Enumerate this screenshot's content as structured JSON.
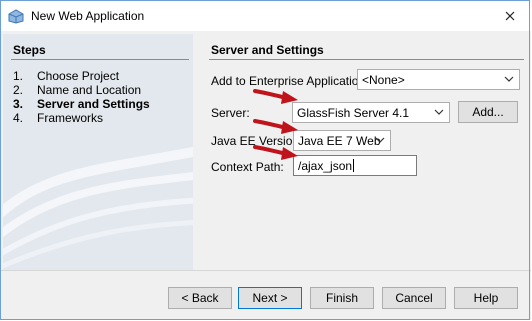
{
  "window": {
    "title": "New Web Application",
    "app_icon": "netbeans-project-icon",
    "close_icon": "close-icon"
  },
  "steps": {
    "title": "Steps",
    "items": [
      {
        "num": "1.",
        "label": "Choose Project",
        "active": false
      },
      {
        "num": "2.",
        "label": "Name and Location",
        "active": false
      },
      {
        "num": "3.",
        "label": "Server and Settings",
        "active": true
      },
      {
        "num": "4.",
        "label": "Frameworks",
        "active": false
      }
    ]
  },
  "panel": {
    "title": "Server and Settings",
    "enterprise": {
      "label": "Add to Enterprise Application:",
      "value": "<None>"
    },
    "server": {
      "label": "Server:",
      "value": "GlassFish Server 4.1",
      "add_label": "Add..."
    },
    "javaee": {
      "label": "Java EE Version:",
      "value": "Java EE 7 Web"
    },
    "context": {
      "label": "Context Path:",
      "value": "/ajax_json"
    }
  },
  "buttons": {
    "back": "< Back",
    "next": "Next >",
    "finish": "Finish",
    "cancel": "Cancel",
    "help": "Help"
  },
  "annotations": {
    "arrow_color": "#c0141c",
    "count": 3
  }
}
